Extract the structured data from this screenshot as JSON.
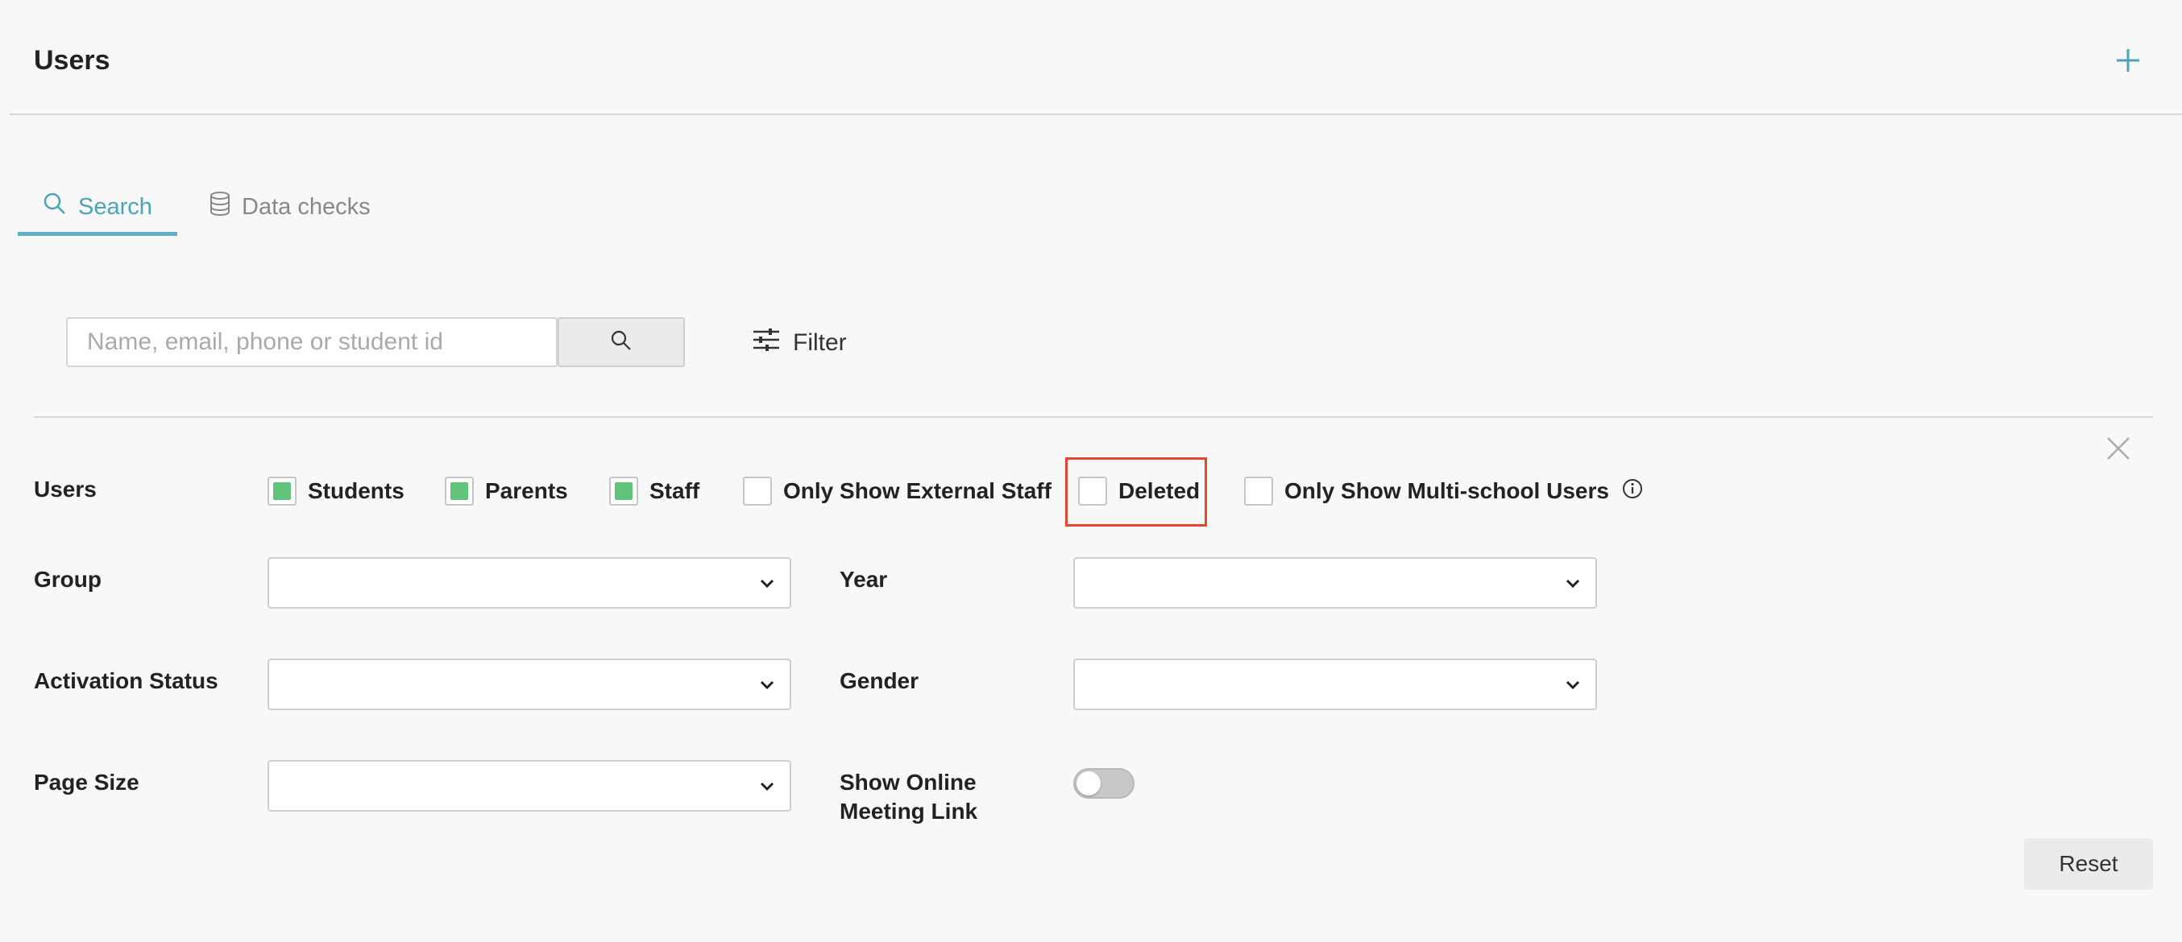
{
  "header": {
    "title": "Users"
  },
  "tabs": [
    {
      "label": "Search",
      "active": true
    },
    {
      "label": "Data checks",
      "active": false
    }
  ],
  "search": {
    "placeholder": "Name, email, phone or student id",
    "value": ""
  },
  "filter": {
    "label": "Filter"
  },
  "filters": {
    "users_label": "Users",
    "user_types": [
      {
        "label": "Students",
        "checked": true
      },
      {
        "label": "Parents",
        "checked": true
      },
      {
        "label": "Staff",
        "checked": true
      },
      {
        "label": "Only Show External Staff",
        "checked": false
      },
      {
        "label": "Deleted",
        "checked": false,
        "highlighted": true
      },
      {
        "label": "Only Show Multi-school Users",
        "checked": false
      }
    ],
    "group_label": "Group",
    "year_label": "Year",
    "activation_status_label": "Activation Status",
    "gender_label": "Gender",
    "page_size_label": "Page Size",
    "online_meeting_label": "Show Online Meeting Link",
    "online_meeting_enabled": false
  },
  "actions": {
    "reset_label": "Reset"
  },
  "colors": {
    "accent": "#4ba3b8",
    "checked": "#62c47a",
    "highlight": "#e5472e"
  }
}
